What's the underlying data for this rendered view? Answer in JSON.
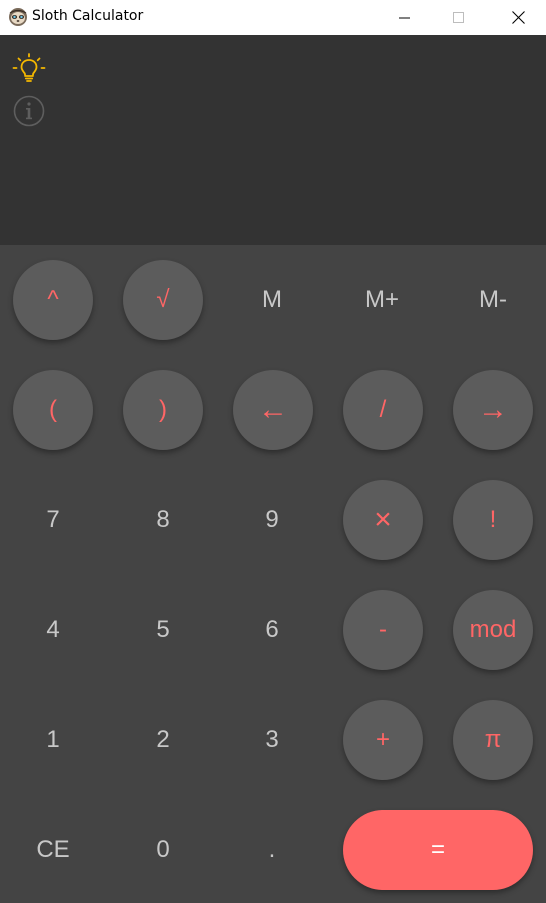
{
  "window": {
    "title": "Sloth Calculator"
  },
  "toolbar": {
    "theme_icon": "lightbulb-icon",
    "info_icon": "info-icon"
  },
  "colors": {
    "accent": "#ff6666",
    "key_bg": "#5c5c5c",
    "pad_bg": "#444444",
    "display_bg": "#333333",
    "bulb": "#f5b800"
  },
  "keys": {
    "pow": "^",
    "sqrt": "√",
    "mem": "M",
    "mem_plus": "M+",
    "mem_minus": "M-",
    "lparen": "(",
    "rparen": ")",
    "backspace": "←",
    "divide": "/",
    "right": "→",
    "seven": "7",
    "eight": "8",
    "nine": "9",
    "multiply": "×",
    "factorial": "!",
    "four": "4",
    "five": "5",
    "six": "6",
    "minus": "-",
    "mod": "mod",
    "one": "1",
    "two": "2",
    "three": "3",
    "plus": "+",
    "pi": "π",
    "clear": "CE",
    "zero": "0",
    "dot": ".",
    "equals": "="
  }
}
